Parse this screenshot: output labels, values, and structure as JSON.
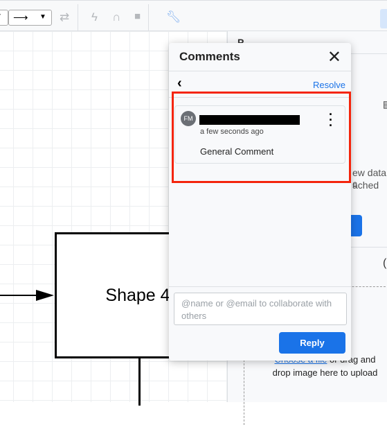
{
  "toolbar": {
    "icons": [
      "dropdown-arrow-icon",
      "arrow-end-icon",
      "swap-icon",
      "lightning-icon",
      "magnet-icon",
      "lock-icon",
      "wrench-icon"
    ]
  },
  "canvas": {
    "shape_label": "Shape 4"
  },
  "panel": {
    "header_initial": "P",
    "text1": "ew data c",
    "text2": "ached",
    "upload_link": "Choose a file",
    "upload_text1": " or drag and",
    "upload_text2": "drop image here to upload"
  },
  "comments": {
    "title": "Comments",
    "resolve": "Resolve",
    "avatar_initials": "FM",
    "author": "[redacted]",
    "time": "a few seconds ago",
    "body": "General Comment",
    "input_placeholder": "@name or @email to collaborate with others",
    "reply": "Reply"
  },
  "colors": {
    "accent": "#1a73e8",
    "highlight": "#f4250c"
  }
}
